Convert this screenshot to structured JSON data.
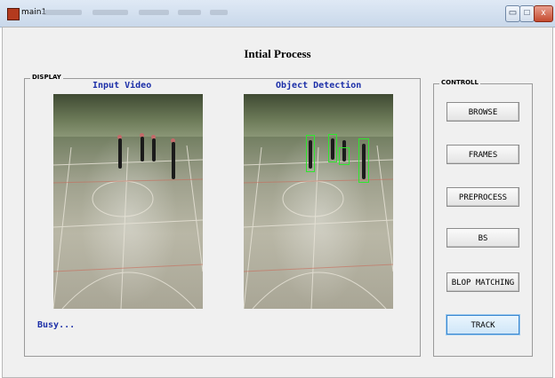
{
  "window": {
    "title": "main1",
    "minimize_symbol": "▭",
    "maximize_symbol": "□",
    "close_symbol": "x",
    "colors": {
      "titlebar": "#c9d8ea",
      "close": "#c44b2f"
    }
  },
  "page": {
    "heading": "Intial Process"
  },
  "display_panel": {
    "legend": "DISPLAY",
    "input_label": "Input Video",
    "output_label": "Object Detection",
    "status": "Busy..."
  },
  "control_panel": {
    "legend": "CONTROLL",
    "buttons": [
      {
        "label": "BROWSE"
      },
      {
        "label": "FRAMES"
      },
      {
        "label": "PREPROCESS"
      },
      {
        "label": "BS"
      },
      {
        "label": "BLOP MATCHING"
      },
      {
        "label": "TRACK",
        "state": "focused"
      }
    ]
  },
  "accent_colors": {
    "label_text": "#1c2fa8",
    "detection_box": "#2ee62e"
  }
}
